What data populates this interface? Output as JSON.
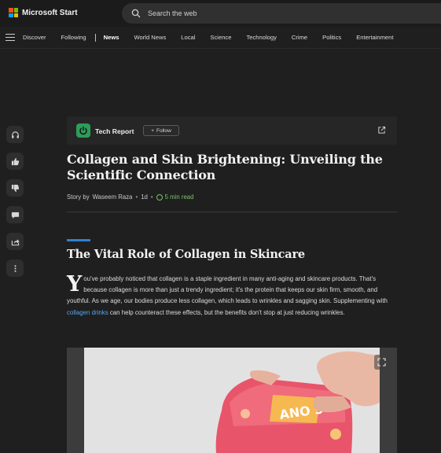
{
  "header": {
    "brand": "Microsoft Start",
    "search_placeholder": "Search the web",
    "logo_colors": [
      "#f25022",
      "#7fba00",
      "#00a4ef",
      "#ffb900"
    ]
  },
  "nav": {
    "items": [
      {
        "label": "Discover",
        "active": false
      },
      {
        "label": "Following",
        "active": false
      },
      {
        "label": "News",
        "active": true
      },
      {
        "label": "World News",
        "active": false
      },
      {
        "label": "Local",
        "active": false
      },
      {
        "label": "Science",
        "active": false
      },
      {
        "label": "Technology",
        "active": false
      },
      {
        "label": "Crime",
        "active": false
      },
      {
        "label": "Politics",
        "active": false
      },
      {
        "label": "Entertainment",
        "active": false
      }
    ]
  },
  "rail": {
    "icons": [
      "headphones-icon",
      "thumbs-up-icon",
      "thumbs-down-icon",
      "comment-icon",
      "share-icon",
      "more-icon"
    ]
  },
  "publisher": {
    "name": "Tech Report",
    "follow_label": "Follow",
    "logo_color": "#2e9d58"
  },
  "article": {
    "title": "Collagen and Skin Brightening: Unveiling the Scientific Connection",
    "byline": {
      "prefix": "Story by",
      "author": "Waseem Raza",
      "age": "1d",
      "read_time": "5 min read"
    },
    "section_heading": "The Vital Role of Collagen in Skincare",
    "paragraph": {
      "dropcap": "Y",
      "text_before_link": "ou've probably noticed that collagen is a staple ingredient in many anti-aging and skincare products. That's because collagen is more than just a trendy ingredient; it's the protein that keeps our skin firm, smooth, and youthful. As we age, our bodies produce less collagen, which leads to wrinkles and sagging skin. Supplementing with ",
      "link_text": "collagen drinks",
      "text_after_link": " can help counteract these effects, but the benefits don't stop at just reducing wrinkles."
    }
  },
  "colors": {
    "accent_blue": "#2f7fd0",
    "link_blue": "#5aa3f0",
    "read_time_green": "#7cc36a",
    "background": "#1f1f1f"
  }
}
